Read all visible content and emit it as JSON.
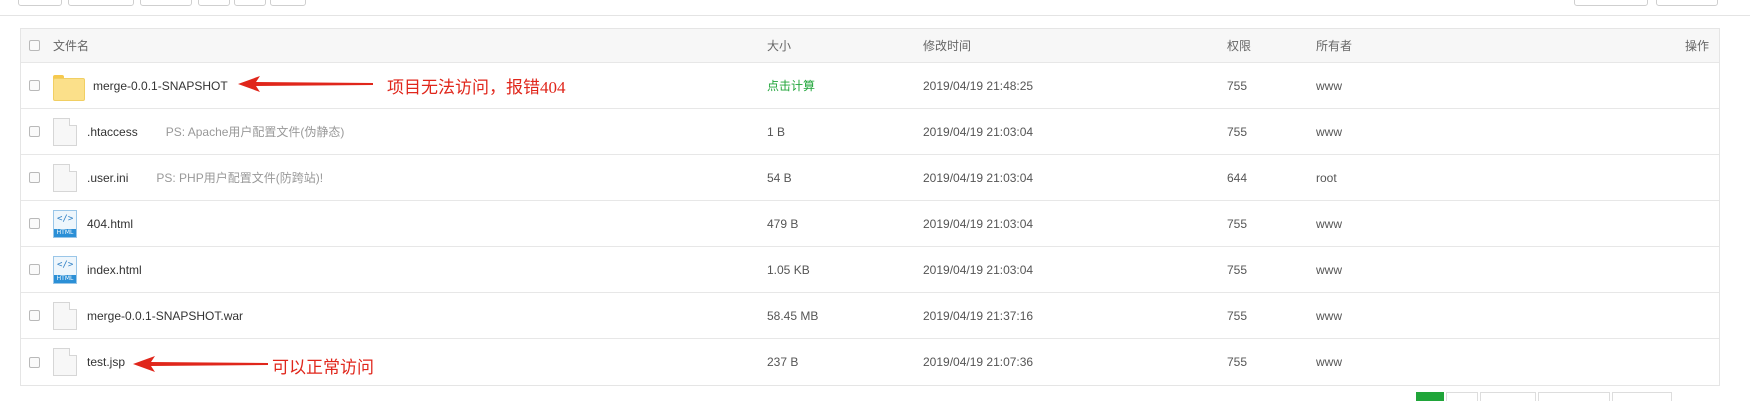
{
  "header": {
    "name": "文件名",
    "size": "大小",
    "mtime": "修改时间",
    "perm": "权限",
    "owner": "所有者",
    "action": "操作"
  },
  "rows": [
    {
      "icon": "folder-icon",
      "name": "merge-0.0.1-SNAPSHOT",
      "note": "",
      "size": "点击计算",
      "mtime": "2019/04/19 21:48:25",
      "perm": "755",
      "owner": "www"
    },
    {
      "icon": "file-icon",
      "name": ".htaccess",
      "note": "PS: Apache用户配置文件(伪静态)",
      "size": "1 B",
      "mtime": "2019/04/19 21:03:04",
      "perm": "755",
      "owner": "www"
    },
    {
      "icon": "file-icon",
      "name": ".user.ini",
      "note": "PS: PHP用户配置文件(防跨站)!",
      "size": "54 B",
      "mtime": "2019/04/19 21:03:04",
      "perm": "644",
      "owner": "root"
    },
    {
      "icon": "html-file-icon",
      "name": "404.html",
      "note": "",
      "size": "479 B",
      "mtime": "2019/04/19 21:03:04",
      "perm": "755",
      "owner": "www"
    },
    {
      "icon": "html-file-icon",
      "name": "index.html",
      "note": "",
      "size": "1.05 KB",
      "mtime": "2019/04/19 21:03:04",
      "perm": "755",
      "owner": "www"
    },
    {
      "icon": "file-icon",
      "name": "merge-0.0.1-SNAPSHOT.war",
      "note": "",
      "size": "58.45 MB",
      "mtime": "2019/04/19 21:37:16",
      "perm": "755",
      "owner": "www"
    },
    {
      "icon": "file-icon",
      "name": "test.jsp",
      "note": "",
      "size": "237 B",
      "mtime": "2019/04/19 21:07:36",
      "perm": "755",
      "owner": "www"
    }
  ],
  "annotations": {
    "folder_error": "项目无法访问，报错404",
    "jsp_ok": "可以正常访问"
  },
  "colors": {
    "accent_green": "#20a53a",
    "annotation_red": "#e0261b",
    "folder_yellow": "#fbe08a"
  }
}
